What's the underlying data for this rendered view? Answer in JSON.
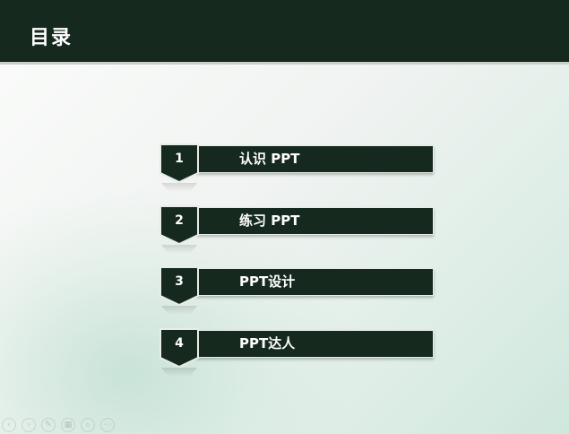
{
  "header": {
    "title": "目录"
  },
  "toc": {
    "items": [
      {
        "number": "1",
        "label": "认识 PPT"
      },
      {
        "number": "2",
        "label": "练习 PPT"
      },
      {
        "number": "3",
        "label": "PPT设计"
      },
      {
        "number": "4",
        "label": "PPT达人"
      }
    ]
  },
  "nav_controls": {
    "icons": [
      "previous-icon",
      "next-icon",
      "pen-icon",
      "slides-icon",
      "zoom-icon",
      "more-icon"
    ],
    "glyphs": [
      "‹",
      "›",
      "✎",
      "▦",
      "⌕",
      "⋯"
    ]
  },
  "colors": {
    "header_bg": "#15291f",
    "bar_bg": "#15291f",
    "text": "#ffffff",
    "background_tint": "#cfe7dc"
  }
}
